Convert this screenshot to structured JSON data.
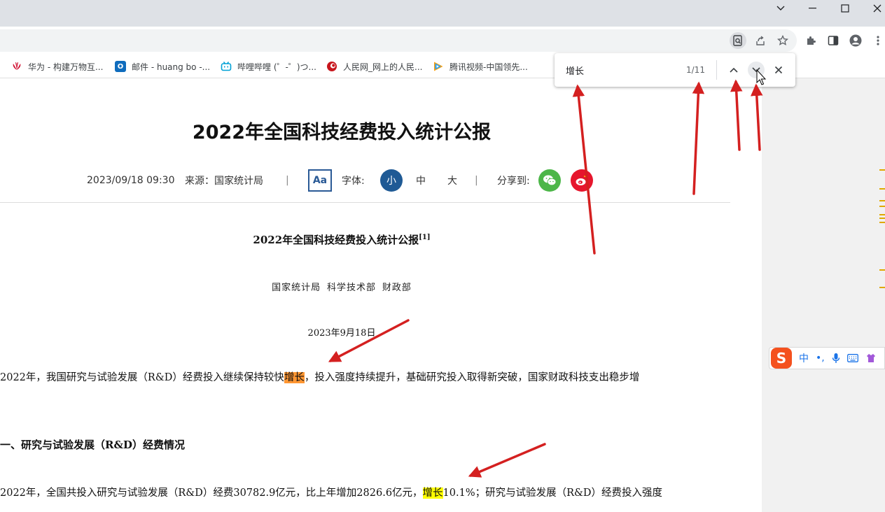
{
  "browser": {
    "window_controls": [
      "chevron-down",
      "minimize",
      "maximize",
      "close"
    ],
    "bookmarks": [
      {
        "label": "华为 - 构建万物互...",
        "icon": "huawei-icon",
        "color": "#cf0a2c"
      },
      {
        "label": "邮件 - huang bo -...",
        "icon": "outlook-icon",
        "color": "#0f6cbd"
      },
      {
        "label": "哔哩哔哩 (゜-゜)つ...",
        "icon": "bilibili-icon",
        "color": "#00a1d6"
      },
      {
        "label": "人民网_网上的人民...",
        "icon": "peoples-daily-icon",
        "color": "#c8161d"
      },
      {
        "label": "腾讯视频-中国领先...",
        "icon": "tencent-video-icon",
        "color": "#20a0ff"
      }
    ]
  },
  "find_bar": {
    "query": "增长",
    "count": "1/11",
    "prev_label": "previous match",
    "next_label": "next match",
    "close_label": "close"
  },
  "article": {
    "title": "2022年全国科技经费投入统计公报",
    "datetime": "2023/09/18 09:30",
    "source": "来源：国家统计局",
    "separator": "|",
    "aa_label": "Aa",
    "font_label": "字体:",
    "font_small": "小",
    "font_medium": "中",
    "font_large": "大",
    "share_label": "分享到:",
    "doc_title": "2022年全国科技经费投入统计公报",
    "doc_title_note": "[1]",
    "doc_authors": "国家统计局 科学技术部 财政部",
    "doc_date": "2023年9月18日",
    "para1_before": "2022年，我国研究与试验发展（R&D）经费投入继续保持较快",
    "para1_match": "增长",
    "para1_after": "，投入强度持续提升，基础研究投入取得新突破，国家财政科技支出稳步增",
    "section_heading": "一、研究与试验发展（R&D）经费情况",
    "para2_before": "2022年，全国共投入研究与试验发展（R&D）经费30782.9亿元，比上年增加2826.6亿元，",
    "para2_match": "增长",
    "para2_after": "10.1%；研究与试验发展（R&D）经费投入强度"
  },
  "ime": {
    "logo": "S",
    "mode": "中",
    "punct": "•,"
  },
  "colors": {
    "annotation_arrow": "#d42020",
    "current_match": "#ff9632",
    "match": "#ffff00",
    "font_size_active": "#1f5a95",
    "wechat": "#4cb648",
    "weibo": "#e6162d"
  }
}
